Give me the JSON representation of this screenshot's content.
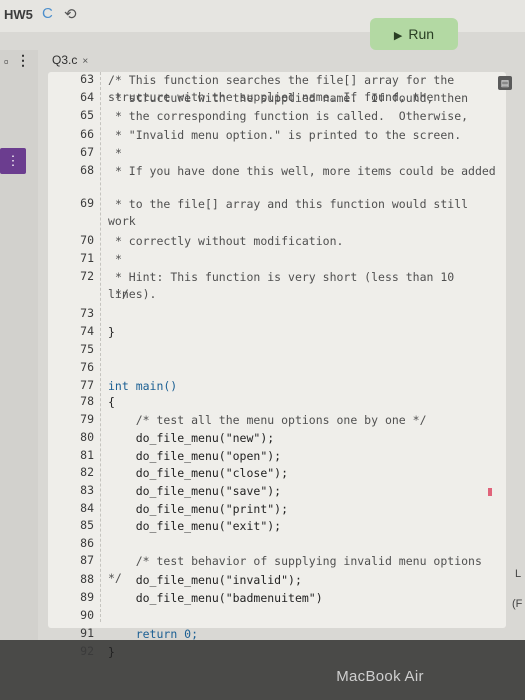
{
  "app": {
    "title": "HW5"
  },
  "toolbar": {
    "run_label": "Run"
  },
  "tab": {
    "label": "Q3.c",
    "close": "×"
  },
  "code_lines": [
    {
      "n": "63",
      "t": "/* This function searches the file[] array for the structure with the supplied name. If found, then"
    },
    {
      "n": "64",
      "t": " * structure with the supplied name.  If found, then"
    },
    {
      "n": "65",
      "t": " * the corresponding function is called.  Otherwise,"
    },
    {
      "n": "66",
      "t": " * \"Invalid menu option.\" is printed to the screen."
    },
    {
      "n": "67",
      "t": " *"
    },
    {
      "n": "68",
      "t": " * If you have done this well, more items could be added"
    },
    {
      "n": "69",
      "t": " * to the file[] array and this function would still work"
    },
    {
      "n": "70",
      "t": " * correctly without modification."
    },
    {
      "n": "71",
      "t": " *"
    },
    {
      "n": "72",
      "t": " * Hint: This function is very short (less than 10 lines)."
    },
    {
      "n": "",
      "t": " */"
    },
    {
      "n": "73",
      "t": ""
    },
    {
      "n": "74",
      "t": "}"
    },
    {
      "n": "75",
      "t": ""
    },
    {
      "n": "76",
      "t": ""
    },
    {
      "n": "77",
      "t": "int main()"
    },
    {
      "n": "78",
      "t": "{"
    },
    {
      "n": "79",
      "t": "    /* test all the menu options one by one */"
    },
    {
      "n": "80",
      "t": "    do_file_menu(\"new\");"
    },
    {
      "n": "81",
      "t": "    do_file_menu(\"open\");"
    },
    {
      "n": "82",
      "t": "    do_file_menu(\"close\");"
    },
    {
      "n": "83",
      "t": "    do_file_menu(\"save\");"
    },
    {
      "n": "84",
      "t": "    do_file_menu(\"print\");"
    },
    {
      "n": "85",
      "t": "    do_file_menu(\"exit\");"
    },
    {
      "n": "86",
      "t": ""
    },
    {
      "n": "87",
      "t": "    /* test behavior of supplying invalid menu options */"
    },
    {
      "n": "88",
      "t": "    do_file_menu(\"invalid\");"
    },
    {
      "n": "89",
      "t": "    do_file_menu(\"badmenuitem\")"
    },
    {
      "n": "90",
      "t": ""
    },
    {
      "n": "91",
      "t": "    return 0;"
    },
    {
      "n": "92",
      "t": "}"
    }
  ],
  "device": {
    "label": "MacBook Air"
  },
  "edge": {
    "a": "L",
    "b": "(F"
  },
  "colors": {
    "run_bg": "#b3d9a3",
    "editor_bg": "#efeeea",
    "keyword": "#1b5f93"
  }
}
